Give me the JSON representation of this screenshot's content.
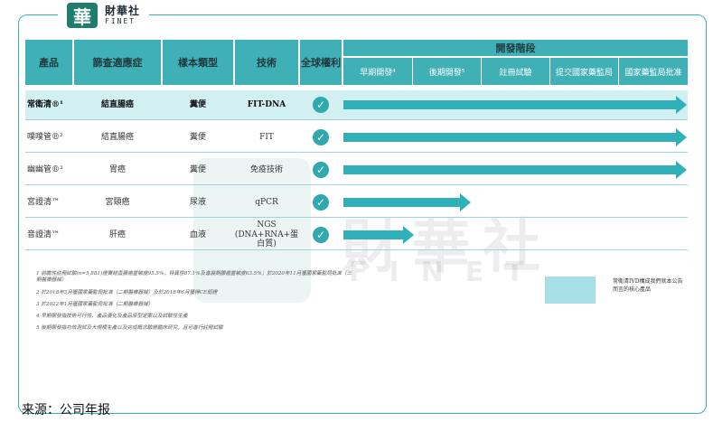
{
  "logo": {
    "mark": "華",
    "cn": "財華社",
    "en": "FINET"
  },
  "table": {
    "headers": {
      "product": "產品",
      "indication": "篩查適應症",
      "sample": "樣本類型",
      "technology": "技術",
      "rights": "全球權利",
      "stage": "開發階段"
    },
    "stages": [
      "早期開發⁴",
      "後期開發⁵",
      "註冊試驗",
      "提交國家藥監局",
      "國家藥監局批准"
    ],
    "rows": [
      {
        "product": "常衛清®¹",
        "indication": "結直腸癌",
        "sample": "糞便",
        "technology": "FIT-DNA",
        "rights": true,
        "progress": 1.0,
        "highlight": true
      },
      {
        "product": "噗噗管®²",
        "indication": "結直腸癌",
        "sample": "糞便",
        "technology": "FIT",
        "rights": true,
        "progress": 1.0,
        "highlight": false
      },
      {
        "product": "幽幽管®³",
        "indication": "胃癌",
        "sample": "糞便",
        "technology": "免疫技術",
        "rights": true,
        "progress": 1.0,
        "highlight": false
      },
      {
        "product": "宮證清™",
        "indication": "宮頸癌",
        "sample": "尿液",
        "technology": "qPCR",
        "rights": true,
        "progress": 0.35,
        "highlight": false
      },
      {
        "product": "音證清™",
        "indication": "肝癌",
        "sample": "血液",
        "technology": "NGS (DNA+RNA+蛋白質)",
        "rights": true,
        "progress": 0.18,
        "highlight": false
      }
    ]
  },
  "notes": [
    "1 前瞻性註冊試驗(n=5,881)證實結直腸癌靈敏度95.5%，特異性87.1%及進展期腺瘤靈敏度63.5%；於2020年11月獲國家藥監局批准（三期醫療器械）",
    "2 於2018年3月獲國家藥監局批准（二期醫療器械）及於2018年6月獲得CE認證",
    "3 於2022年1月獲國家藥監局批准（二期醫療器械）",
    "4 早期開發指技術可行性、產品優化及產品原型定案以及試驗性生產",
    "5 後期開發指功效測試及大規模生產以及完成概念驗證臨床研究，且可進行註冊試驗"
  ],
  "legend": {
    "text": "常衛清IVD構成我們就本公告而言的核心產品",
    "color": "#a6dfe5"
  },
  "watermark": {
    "cn": "財華社",
    "en": "FINET"
  },
  "source": "来源：公司年报",
  "colors": {
    "header": "#3fb0b6",
    "arrow": "#30b1b9",
    "highlight_row": "#d2eff2",
    "frame": "#3bb0b3"
  }
}
